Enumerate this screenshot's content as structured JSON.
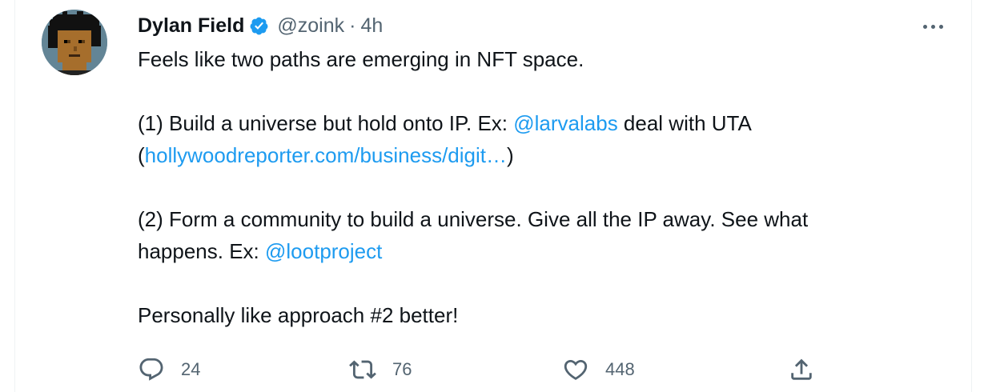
{
  "tweet": {
    "author_name": "Dylan Field",
    "handle": "@zoink",
    "separator": "·",
    "time": "4h",
    "lines": {
      "l1": "Feels like two paths are emerging in NFT space.",
      "l2a": "(1) Build a universe but hold onto IP. Ex: ",
      "l2_mention": "@larvalabs",
      "l2b": " deal with UTA",
      "l3a": "(",
      "l3_link": "hollywoodreporter.com/business/digit…",
      "l3b": ")",
      "l4": "(2) Form a community to build a universe. Give all the IP away. See what",
      "l5a": "happens. Ex: ",
      "l5_mention": "@lootproject",
      "l6": "Personally like approach #2 better!"
    }
  },
  "actions": {
    "reply_count": "24",
    "retweet_count": "76",
    "like_count": "448"
  },
  "icons": {
    "verified": "verified-badge-icon",
    "more": "more-options-icon",
    "reply": "reply-icon",
    "retweet": "retweet-icon",
    "like": "heart-icon",
    "share": "share-icon"
  },
  "colors": {
    "link": "#1d9bf0",
    "secondary_text": "#536471",
    "primary_text": "#0f1419",
    "avatar_bg": "#638596"
  }
}
